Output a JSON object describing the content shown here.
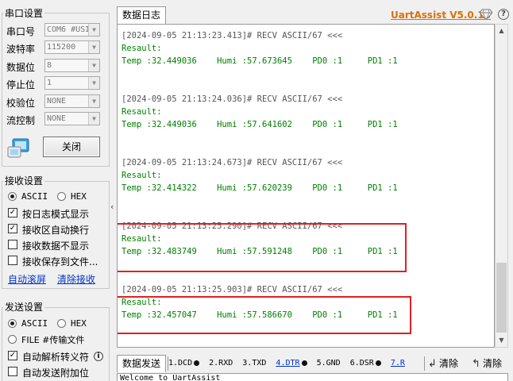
{
  "serial_settings": {
    "title": "串口设置",
    "fields": [
      {
        "label": "串口号",
        "value": "COM6 #USI"
      },
      {
        "label": "波特率",
        "value": "115200"
      },
      {
        "label": "数据位",
        "value": "8"
      },
      {
        "label": "停止位",
        "value": "1"
      },
      {
        "label": "校验位",
        "value": "NONE"
      },
      {
        "label": "流控制",
        "value": "NONE"
      }
    ],
    "close_button": "关闭",
    "port_icon": "serial-port-icon"
  },
  "receive_settings": {
    "title": "接收设置",
    "format_ascii": "ASCII",
    "format_hex": "HEX",
    "selected_format": "ASCII",
    "options": [
      {
        "label": "按日志模式显示",
        "checked": true
      },
      {
        "label": "接收区自动换行",
        "checked": true
      },
      {
        "label": "接收数据不显示",
        "checked": false
      },
      {
        "label": "接收保存到文件...",
        "checked": false
      }
    ],
    "auto_scroll": "自动滚屏",
    "clear_receive": "清除接收"
  },
  "send_settings": {
    "title": "发送设置",
    "format_ascii": "ASCII",
    "format_hex": "HEX",
    "file_source": "FILE #传输文件",
    "options": [
      {
        "label": "自动解析转义符",
        "checked": true
      },
      {
        "label": "自动发送附加位",
        "checked": false
      }
    ],
    "info_icon": "info-icon"
  },
  "header": {
    "tab_log": "数据日志",
    "brand": "UartAssist V5.0.13",
    "icons": [
      "gem-icon",
      "help-icon"
    ]
  },
  "log_entries": [
    {
      "head": "[2024-09-05 21:13:23.413]# RECV ASCII/67 <<<",
      "line1": "Resault:",
      "line2": "Temp :32.449036    Humi :57.673645    PD0 :1     PD1 :1"
    },
    {
      "head": "[2024-09-05 21:13:24.036]# RECV ASCII/67 <<<",
      "line1": "Resault:",
      "line2": "Temp :32.449036    Humi :57.641602    PD0 :1     PD1 :1"
    },
    {
      "head": "[2024-09-05 21:13:24.673]# RECV ASCII/67 <<<",
      "line1": "Resault:",
      "line2": "Temp :32.414322    Humi :57.620239    PD0 :1     PD1 :1"
    },
    {
      "head": "[2024-09-05 21:13:25.290]# RECV ASCII/67 <<<",
      "line1": "Resault:",
      "line2": "Temp :32.483749    Humi :57.591248    PD0 :1     PD1 :1"
    },
    {
      "head": "[2024-09-05 21:13:25.903]# RECV ASCII/67 <<<",
      "line1": "Resault:",
      "line2": "Temp :32.457047    Humi :57.586670    PD0 :1     PD1 :1"
    }
  ],
  "bottom": {
    "tab_send": "数据发送",
    "status": [
      {
        "label": "1.DCD",
        "dot": true,
        "link": false
      },
      {
        "label": "2.RXD",
        "dot": false,
        "link": false
      },
      {
        "label": "3.TXD",
        "dot": false,
        "link": false
      },
      {
        "label": "4.DTR",
        "dot": true,
        "link": true
      },
      {
        "label": "5.GND",
        "dot": false,
        "link": false
      },
      {
        "label": "6.DSR",
        "dot": true,
        "link": false
      },
      {
        "label": "7.R",
        "dot": false,
        "link": true
      }
    ],
    "clear_button": "清除",
    "clear_all_button": "清除",
    "send_text": "Welcome to UartAssist"
  },
  "colors": {
    "brand": "#e07000",
    "log_data": "#008000",
    "highlight": "#e02020",
    "link": "#0033cc"
  }
}
